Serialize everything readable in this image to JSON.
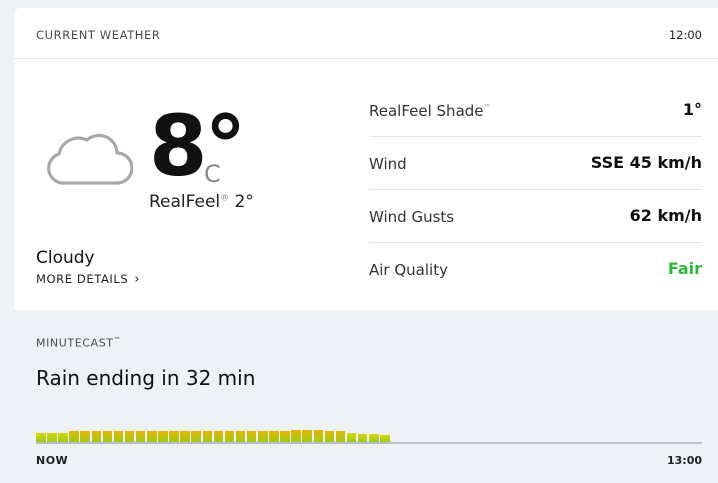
{
  "header": {
    "title": "CURRENT WEATHER",
    "time": "12:00"
  },
  "current": {
    "icon": "cloud-icon",
    "temperature": "8°",
    "unit": "C",
    "realfeel_label": "RealFeel",
    "realfeel_value": "2°",
    "condition": "Cloudy",
    "more_details": "MORE DETAILS"
  },
  "details": [
    {
      "label": "RealFeel Shade",
      "value": "1°"
    },
    {
      "label": "Wind",
      "value": "SSE 45 km/h"
    },
    {
      "label": "Wind Gusts",
      "value": "62 km/h"
    },
    {
      "label": "Air Quality",
      "value": "Fair"
    }
  ],
  "colors": {
    "fair": "#2fb83e",
    "bar_low": "#d6d60a",
    "bar_high": "#e8b400"
  },
  "minutecast": {
    "title": "MINUTECAST",
    "summary": "Rain ending in 32 min",
    "start_label": "NOW",
    "end_label": "13:00",
    "intensity": [
      0.6,
      0.6,
      0.6,
      0.7,
      0.7,
      0.75,
      0.75,
      0.7,
      0.7,
      0.75,
      0.75,
      0.75,
      0.75,
      0.75,
      0.7,
      0.7,
      0.75,
      0.7,
      0.7,
      0.7,
      0.7,
      0.75,
      0.75,
      0.8,
      0.8,
      0.8,
      0.75,
      0.75,
      0.6,
      0.55,
      0.5,
      0.45
    ]
  }
}
